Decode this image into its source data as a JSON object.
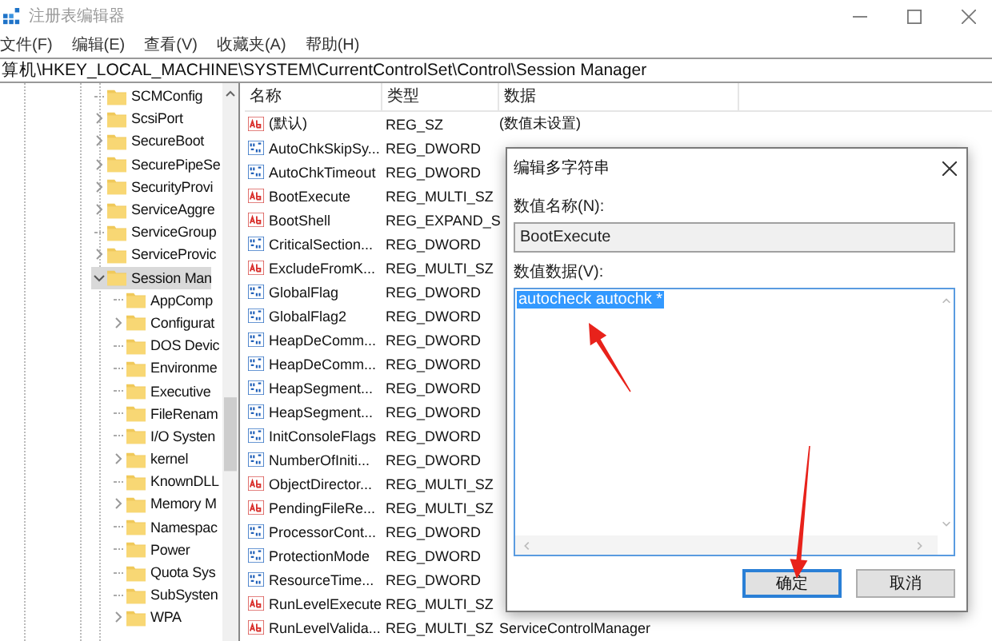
{
  "window": {
    "title": "注册表编辑器"
  },
  "menu": [
    "文件(F)",
    "编辑(E)",
    "查看(V)",
    "收藏夹(A)",
    "帮助(H)"
  ],
  "address": "算机\\HKEY_LOCAL_MACHINE\\SYSTEM\\CurrentControlSet\\Control\\Session Manager",
  "tree": {
    "items": [
      {
        "label": "SCMConfig",
        "has_children": false,
        "expanded": false,
        "selected": false
      },
      {
        "label": "ScsiPort",
        "has_children": true,
        "expanded": false,
        "selected": false
      },
      {
        "label": "SecureBoot",
        "has_children": true,
        "expanded": false,
        "selected": false
      },
      {
        "label": "SecurePipeSe",
        "has_children": true,
        "expanded": false,
        "selected": false
      },
      {
        "label": "SecurityProvi",
        "has_children": true,
        "expanded": false,
        "selected": false
      },
      {
        "label": "ServiceAggre",
        "has_children": true,
        "expanded": false,
        "selected": false
      },
      {
        "label": "ServiceGroup",
        "has_children": false,
        "expanded": false,
        "selected": false
      },
      {
        "label": "ServiceProvic",
        "has_children": true,
        "expanded": false,
        "selected": false
      },
      {
        "label": "Session Man",
        "has_children": true,
        "expanded": true,
        "selected": true,
        "children": [
          {
            "label": "AppComp",
            "has_children": false,
            "expanded": false,
            "selected": false
          },
          {
            "label": "Configurat",
            "has_children": true,
            "expanded": false,
            "selected": false
          },
          {
            "label": "DOS Devic",
            "has_children": false,
            "expanded": false,
            "selected": false
          },
          {
            "label": "Environme",
            "has_children": false,
            "expanded": false,
            "selected": false
          },
          {
            "label": "Executive",
            "has_children": false,
            "expanded": false,
            "selected": false
          },
          {
            "label": "FileRenam",
            "has_children": false,
            "expanded": false,
            "selected": false
          },
          {
            "label": "I/O Systen",
            "has_children": false,
            "expanded": false,
            "selected": false
          },
          {
            "label": "kernel",
            "has_children": true,
            "expanded": false,
            "selected": false
          },
          {
            "label": "KnownDLL",
            "has_children": false,
            "expanded": false,
            "selected": false
          },
          {
            "label": "Memory M",
            "has_children": true,
            "expanded": false,
            "selected": false
          },
          {
            "label": "Namespac",
            "has_children": false,
            "expanded": false,
            "selected": false
          },
          {
            "label": "Power",
            "has_children": false,
            "expanded": false,
            "selected": false
          },
          {
            "label": "Quota Sys",
            "has_children": false,
            "expanded": false,
            "selected": false
          },
          {
            "label": "SubSysten",
            "has_children": false,
            "expanded": false,
            "selected": false
          },
          {
            "label": "WPA",
            "has_children": true,
            "expanded": false,
            "selected": false
          }
        ]
      }
    ]
  },
  "table": {
    "columns": [
      "名称",
      "类型",
      "数据"
    ],
    "rows": [
      {
        "kind": "string",
        "name": "(默认)",
        "type": "REG_SZ",
        "data": "(数值未设置)"
      },
      {
        "kind": "binary",
        "name": "AutoChkSkipSy...",
        "type": "REG_DWORD"
      },
      {
        "kind": "binary",
        "name": "AutoChkTimeout",
        "type": "REG_DWORD"
      },
      {
        "kind": "string",
        "name": "BootExecute",
        "type": "REG_MULTI_SZ"
      },
      {
        "kind": "string",
        "name": "BootShell",
        "type": "REG_EXPAND_S"
      },
      {
        "kind": "binary",
        "name": "CriticalSection...",
        "type": "REG_DWORD"
      },
      {
        "kind": "string",
        "name": "ExcludeFromK...",
        "type": "REG_MULTI_SZ"
      },
      {
        "kind": "binary",
        "name": "GlobalFlag",
        "type": "REG_DWORD"
      },
      {
        "kind": "binary",
        "name": "GlobalFlag2",
        "type": "REG_DWORD"
      },
      {
        "kind": "binary",
        "name": "HeapDeComm...",
        "type": "REG_DWORD"
      },
      {
        "kind": "binary",
        "name": "HeapDeComm...",
        "type": "REG_DWORD"
      },
      {
        "kind": "binary",
        "name": "HeapSegment...",
        "type": "REG_DWORD"
      },
      {
        "kind": "binary",
        "name": "HeapSegment...",
        "type": "REG_DWORD"
      },
      {
        "kind": "binary",
        "name": "InitConsoleFlags",
        "type": "REG_DWORD"
      },
      {
        "kind": "binary",
        "name": "NumberOfIniti...",
        "type": "REG_DWORD"
      },
      {
        "kind": "string",
        "name": "ObjectDirector...",
        "type": "REG_MULTI_SZ"
      },
      {
        "kind": "string",
        "name": "PendingFileRe...",
        "type": "REG_MULTI_SZ"
      },
      {
        "kind": "binary",
        "name": "ProcessorCont...",
        "type": "REG_DWORD"
      },
      {
        "kind": "binary",
        "name": "ProtectionMode",
        "type": "REG_DWORD"
      },
      {
        "kind": "binary",
        "name": "ResourceTime...",
        "type": "REG_DWORD"
      },
      {
        "kind": "string",
        "name": "RunLevelExecute",
        "type": "REG_MULTI_SZ"
      },
      {
        "kind": "string",
        "name": "RunLevelValida...",
        "type": "REG_MULTI_SZ",
        "data": "ServiceControlManager"
      }
    ]
  },
  "dialog": {
    "title": "编辑多字符串",
    "name_label": "数值名称(N):",
    "name_value": "BootExecute",
    "data_label": "数值数据(V):",
    "data_value": {
      "text": "autocheck autochk *",
      "selected": true,
      "arrow": true
    },
    "buttons": [
      {
        "label": "确定",
        "default": true,
        "arrow": true
      },
      {
        "label": "取消",
        "default": false,
        "arrow": false
      }
    ]
  }
}
